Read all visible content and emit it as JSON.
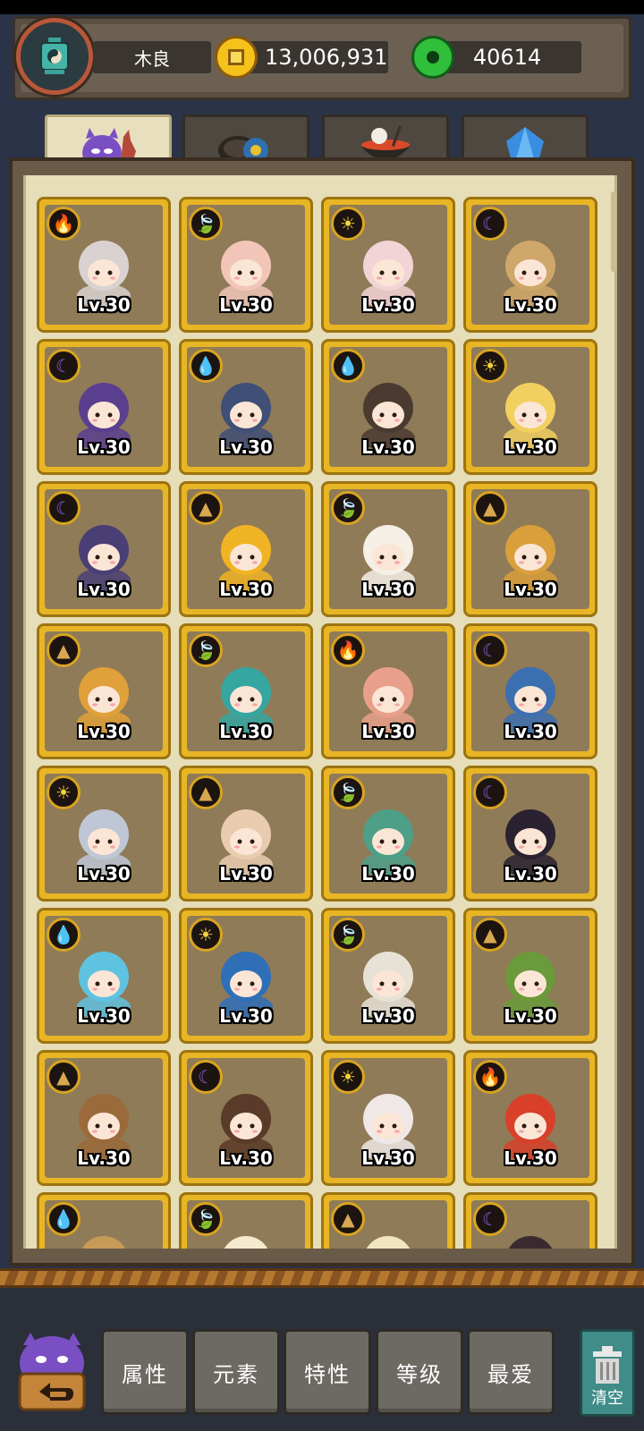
{
  "player": {
    "name": "木良",
    "coins": "13,006,931",
    "gems": "40614"
  },
  "tabs": [
    {
      "name": "heroes",
      "icon": "demon-heroes-icon",
      "active": true
    },
    {
      "name": "equipment",
      "icon": "gear-pot-icon",
      "active": false
    },
    {
      "name": "food",
      "icon": "food-bowl-icon",
      "active": false
    },
    {
      "name": "crystal",
      "icon": "blue-crystal-icon",
      "active": false
    }
  ],
  "heroes": [
    {
      "level": "Lv.30",
      "element": "fire",
      "color": "#d9d2d0"
    },
    {
      "level": "Lv.30",
      "element": "wood",
      "color": "#f1c6b8"
    },
    {
      "level": "Lv.30",
      "element": "light",
      "color": "#f3d4d6"
    },
    {
      "level": "Lv.30",
      "element": "dark",
      "color": "#cfa76a"
    },
    {
      "level": "Lv.30",
      "element": "dark",
      "color": "#5a3f8f"
    },
    {
      "level": "Lv.30",
      "element": "water",
      "color": "#3f4f75"
    },
    {
      "level": "Lv.30",
      "element": "water",
      "color": "#4a3a30"
    },
    {
      "level": "Lv.30",
      "element": "light",
      "color": "#f2d060"
    },
    {
      "level": "Lv.30",
      "element": "dark",
      "color": "#4a3f75"
    },
    {
      "level": "Lv.30",
      "element": "earth",
      "color": "#f0b324"
    },
    {
      "level": "Lv.30",
      "element": "wood",
      "color": "#f6efe6"
    },
    {
      "level": "Lv.30",
      "element": "earth",
      "color": "#d89f3a"
    },
    {
      "level": "Lv.30",
      "element": "earth",
      "color": "#e0a03a"
    },
    {
      "level": "Lv.30",
      "element": "wood",
      "color": "#35a6a0"
    },
    {
      "level": "Lv.30",
      "element": "fire",
      "color": "#e8a08a"
    },
    {
      "level": "Lv.30",
      "element": "dark",
      "color": "#3c6fb0"
    },
    {
      "level": "Lv.30",
      "element": "light",
      "color": "#bfc7d6"
    },
    {
      "level": "Lv.30",
      "element": "earth",
      "color": "#e9ccb0"
    },
    {
      "level": "Lv.30",
      "element": "wood",
      "color": "#4d9f88"
    },
    {
      "level": "Lv.30",
      "element": "dark",
      "color": "#2a2230"
    },
    {
      "level": "Lv.30",
      "element": "water",
      "color": "#5fc2e0"
    },
    {
      "level": "Lv.30",
      "element": "light",
      "color": "#2f6fb8"
    },
    {
      "level": "Lv.30",
      "element": "wood",
      "color": "#e8e2d6"
    },
    {
      "level": "Lv.30",
      "element": "earth",
      "color": "#6a9a3a"
    },
    {
      "level": "Lv.30",
      "element": "earth",
      "color": "#9a6a3a"
    },
    {
      "level": "Lv.30",
      "element": "dark",
      "color": "#5a3a28"
    },
    {
      "level": "Lv.30",
      "element": "light",
      "color": "#efe8e6"
    },
    {
      "level": "Lv.30",
      "element": "fire",
      "color": "#d8402a"
    },
    {
      "level": "",
      "element": "water",
      "color": "#c89a58"
    },
    {
      "level": "",
      "element": "wood",
      "color": "#f4ead0"
    },
    {
      "level": "",
      "element": "earth",
      "color": "#f2e6c0"
    },
    {
      "level": "",
      "element": "dark",
      "color": "#3a2a30"
    }
  ],
  "element_icons": {
    "fire": "🔥",
    "wood": "🍃",
    "light": "☀",
    "dark": "☾",
    "water": "💧",
    "earth": "▲"
  },
  "element_colors": {
    "fire": "#f0602a",
    "wood": "#7bc64a",
    "light": "#f6d23a",
    "dark": "#8a5cd8",
    "water": "#4aa6e8",
    "earth": "#d8a850"
  },
  "sort_buttons": [
    "属性",
    "元素",
    "特性",
    "等级",
    "最爱"
  ],
  "clear_label": "清空"
}
